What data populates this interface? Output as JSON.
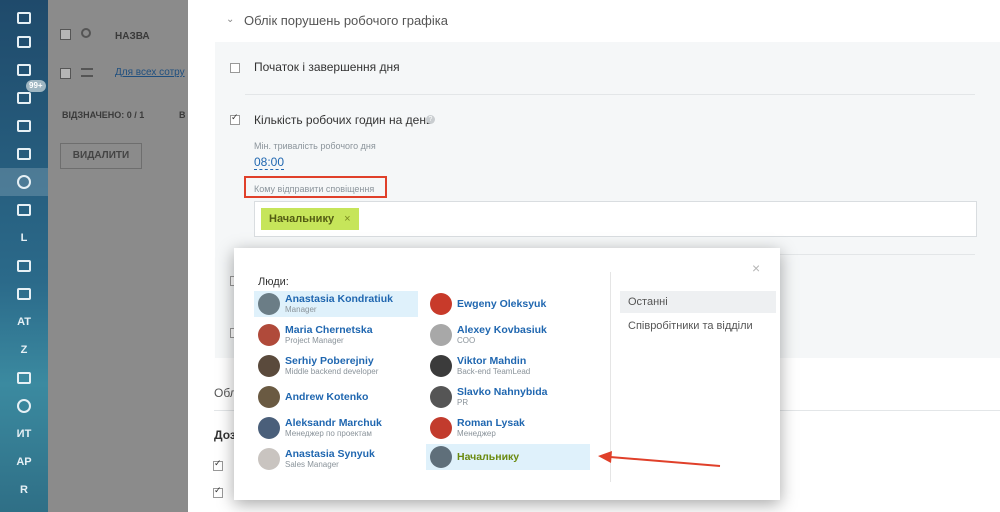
{
  "sidebar": {
    "items": [
      {
        "icon": "stack-icon",
        "label": ""
      },
      {
        "icon": "calendar-icon",
        "label": ""
      },
      {
        "icon": "mail-icon",
        "label": ""
      },
      {
        "icon": "filter-icon",
        "label": "",
        "badge": "99+"
      },
      {
        "icon": "window-icon",
        "label": ""
      },
      {
        "icon": "group-icon",
        "label": ""
      },
      {
        "icon": "clock-icon",
        "label": ""
      },
      {
        "icon": "id-card-icon",
        "label": ""
      },
      {
        "icon": "",
        "label": "L"
      },
      {
        "icon": "cart-icon",
        "label": ""
      },
      {
        "icon": "grid-icon",
        "label": ""
      },
      {
        "icon": "",
        "label": "AT"
      },
      {
        "icon": "",
        "label": "Z"
      },
      {
        "icon": "bar-chart-icon",
        "label": ""
      },
      {
        "icon": "timer-icon",
        "label": ""
      },
      {
        "icon": "",
        "label": "ИТ"
      },
      {
        "icon": "",
        "label": "AP"
      },
      {
        "icon": "",
        "label": "R"
      }
    ]
  },
  "grid": {
    "column_name": "НАЗВА",
    "row_text": "Для всех сотру",
    "selected": "ВІДЗНАЧЕНО: 0 / 1",
    "selected_extra": "В",
    "delete_button": "ВИДАЛИТИ"
  },
  "panel": {
    "section_title": "Облік порушень робочого графіка",
    "option1": "Початок і завершення дня",
    "option2": "Кількість робочих годин на день",
    "min_duration_label": "Мін. тривалість робочого дня",
    "min_duration_value": "08:00",
    "notify_label": "Кому відправити сповіщення",
    "tag": "Начальнику",
    "tag_remove": "×",
    "below_title": "Обл",
    "below_sub": "Доз"
  },
  "popup": {
    "close": "×",
    "people_label": "Люди:",
    "people": [
      {
        "name": "Anastasia Kondratiuk",
        "role": "Manager",
        "color": "#6b7d86",
        "selected": true
      },
      {
        "name": "Maria Chernetska",
        "role": "Project Manager",
        "color": "#b04a3a"
      },
      {
        "name": "Serhiy Poberejniy",
        "role": "Middle backend developer",
        "color": "#5a4a3c"
      },
      {
        "name": "Andrew Kotenko",
        "role": "",
        "color": "#6a5a42"
      },
      {
        "name": "Aleksandr Marchuk",
        "role": "Менеджер по проектам",
        "color": "#4a5f7a"
      },
      {
        "name": "Anastasia Synyuk",
        "role": "Sales Manager",
        "color": "#c9c4c0"
      },
      {
        "name": "Ewgeny Oleksyuk",
        "role": "",
        "color": "#c83a2a"
      },
      {
        "name": "Alexey Kovbasiuk",
        "role": "COO",
        "color": "#a8a8a8"
      },
      {
        "name": "Viktor Mahdin",
        "role": "Back-end TeamLead",
        "color": "#3b3b3b"
      },
      {
        "name": "Slavko Nahnybida",
        "role": "PR",
        "color": "#555555"
      },
      {
        "name": "Roman Lysak",
        "role": "Менеджер",
        "color": "#c23b2d"
      }
    ],
    "group_item": "Начальнику",
    "tabs": [
      "Останні",
      "Співробітники та відділи"
    ]
  },
  "colors": {
    "accent_link": "#2067b0",
    "tag_bg": "#c6e55a",
    "highlight_red": "#e0402a"
  }
}
